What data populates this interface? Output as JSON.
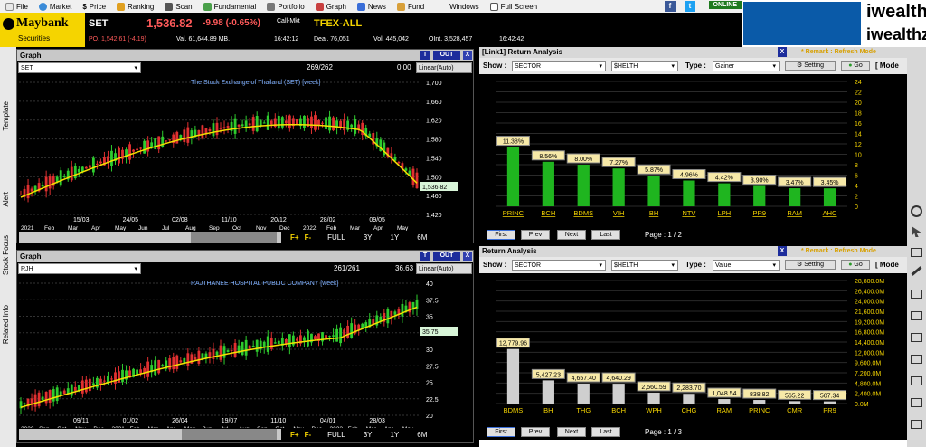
{
  "menu": {
    "items": [
      "File",
      "Market",
      "Price",
      "Ranking",
      "Scan",
      "Fundamental",
      "Portfolio",
      "Graph",
      "News",
      "Fund",
      "Windows",
      "Full Screen"
    ],
    "status": "ONLINE"
  },
  "brand": {
    "name": "Maybank",
    "sub": "Securities"
  },
  "set": {
    "label": "SET",
    "value": "1,536.82",
    "change": "-9.98 (-0.65%)",
    "state": "Call-Mkt",
    "po": "PO. 1,542.61 (-4.19)",
    "val": "Val. 61,644.89 MB.",
    "time": "16:42:12"
  },
  "tfex": {
    "label": "TFEX-ALL",
    "deal": "Deal. 76,051",
    "vol": "Vol. 445,042",
    "oint": "OInt. 3,528,457",
    "time": "16:42:42"
  },
  "ad": {
    "brand1": "iwealthz",
    "brand2": "iwealthz"
  },
  "sidetabs": [
    "Template",
    "Alert",
    "Stock Focus",
    "Related Info"
  ],
  "graph1": {
    "header": "Graph",
    "symbol": "SET",
    "count": "269/262",
    "num": "0.00",
    "scale": "Linear(Auto)",
    "title": "The Stock Exchange of Thailand (SET) [week]",
    "price_tag": "1,536.82",
    "yticks": [
      "1,700",
      "1,660",
      "1,620",
      "1,580",
      "1,540",
      "1,500",
      "1,460",
      "1,420"
    ],
    "dates": [
      "15/03",
      "24/05",
      "02/08",
      "11/10",
      "20/12",
      "28/02",
      "09/05"
    ],
    "months": [
      "2021",
      "Feb",
      "Mar",
      "Apr",
      "May",
      "Jun",
      "Jul",
      "Aug",
      "Sep",
      "Oct",
      "Nov",
      "Dec",
      "2022",
      "Feb",
      "Mar",
      "Apr",
      "May"
    ],
    "nav": [
      "FULL",
      "3Y",
      "1Y",
      "6M"
    ],
    "t": "T",
    "out": "OUT",
    "x": "X",
    "f1": "F+",
    "f2": "F-"
  },
  "graph2": {
    "header": "Graph",
    "symbol": "RJH",
    "count": "261/261",
    "num": "36.63",
    "scale": "Linear(Auto)",
    "title": "RAJTHANEE HOSPITAL PUBLIC COMPANY [week]",
    "price_tag": "35.75",
    "yticks": [
      "40",
      "37.5",
      "35",
      "32.5",
      "30",
      "27.5",
      "25",
      "22.5",
      "20"
    ],
    "dates": [
      "09/11",
      "01/02",
      "26/04",
      "19/07",
      "11/10",
      "04/01",
      "28/03"
    ],
    "months": [
      "2020",
      "Sep",
      "Oct",
      "Nov",
      "Dec",
      "2021",
      "Feb",
      "Mar",
      "Apr",
      "May",
      "Jun",
      "Jul",
      "Aug",
      "Sep",
      "Oct",
      "Nov",
      "Dec",
      "2022",
      "Feb",
      "Mar",
      "Apr",
      "May"
    ],
    "nav": [
      "FULL",
      "3Y",
      "1Y",
      "6M"
    ],
    "t": "T",
    "out": "OUT",
    "x": "X",
    "f1": "F+",
    "f2": "F-"
  },
  "ret1": {
    "header": "[Link1] Return Analysis",
    "remark": "* Remark : Refresh Mode",
    "show_label": "Show :",
    "show_val": "SECTOR",
    "sector": "$HELTH",
    "type_label": "Type :",
    "type_val": "Gainer",
    "setting": "Setting",
    "go": "Go",
    "mode": "[ Mode",
    "page": "Page : 1 / 2",
    "nav": [
      "First",
      "Prev",
      "Next",
      "Last"
    ],
    "yticks": [
      "24",
      "22",
      "20",
      "18",
      "16",
      "14",
      "12",
      "10",
      "8",
      "6",
      "4",
      "2",
      "0"
    ]
  },
  "ret2": {
    "header": "Return Analysis",
    "remark": "* Remark : Refresh Mode",
    "show_label": "Show :",
    "show_val": "SECTOR",
    "sector": "$HELTH",
    "type_label": "Type :",
    "type_val": "Value",
    "setting": "Setting",
    "go": "Go",
    "mode": "[ Mode",
    "page": "Page : 1 / 3",
    "nav": [
      "First",
      "Prev",
      "Next",
      "Last"
    ],
    "yticks": [
      "28,800.0M",
      "26,400.0M",
      "24,000.0M",
      "21,600.0M",
      "19,200.0M",
      "16,800.0M",
      "14,400.0M",
      "12,000.0M",
      "9,600.0M",
      "7,200.0M",
      "4,800.0M",
      "2,400.0M",
      "0.0M"
    ]
  },
  "chart_data": [
    {
      "type": "bar",
      "title": "Return Analysis - Gainer",
      "categories": [
        "PRINC",
        "BCH",
        "BDMS",
        "VIH",
        "BH",
        "NTV",
        "LPH",
        "PR9",
        "RAM",
        "AHC"
      ],
      "values": [
        11.38,
        8.56,
        8.0,
        7.27,
        5.87,
        4.96,
        4.42,
        3.9,
        3.47,
        3.45
      ],
      "labels": [
        "11.38%",
        "8.56%",
        "8.00%",
        "7.27%",
        "5.87%",
        "4.96%",
        "4.42%",
        "3.90%",
        "3.47%",
        "3.45%"
      ],
      "ylim": [
        0,
        24
      ],
      "color": "#1fb51f"
    },
    {
      "type": "bar",
      "title": "Return Analysis - Value",
      "categories": [
        "BDMS",
        "BH",
        "THG",
        "BCH",
        "WPH",
        "CHG",
        "RAM",
        "PRINC",
        "CMR",
        "PR9"
      ],
      "values": [
        12779.96,
        5427.23,
        4657.4,
        4640.29,
        2560.59,
        2283.7,
        1048.54,
        838.82,
        565.22,
        507.34
      ],
      "labels": [
        "12,779.96",
        "5,427.23",
        "4,657.40",
        "4,640.29",
        "2,560.59",
        "2,283.70",
        "1,048.54",
        "838.82",
        "565.22",
        "507.34"
      ],
      "ylim": [
        0,
        28800
      ],
      "color": "#cfcfcf"
    }
  ]
}
